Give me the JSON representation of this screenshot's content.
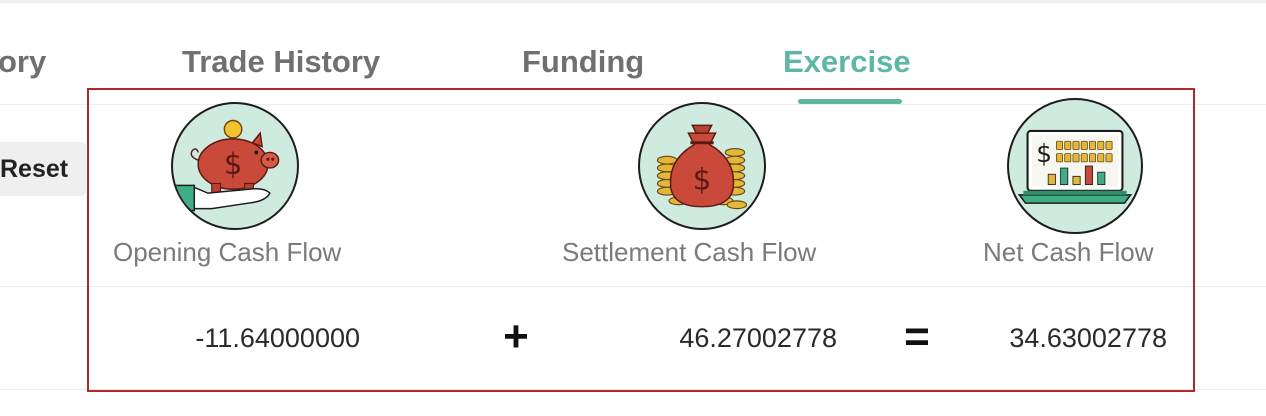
{
  "tabs": [
    {
      "label": "ory",
      "active": false
    },
    {
      "label": "Trade History",
      "active": false
    },
    {
      "label": "Funding",
      "active": false
    },
    {
      "label": "Exercise",
      "active": true
    }
  ],
  "actions": {
    "reset_label": "Reset"
  },
  "cash_flows": {
    "opening": {
      "label": "Opening Cash Flow",
      "value": "-11.64000000",
      "icon": "piggy-bank-icon"
    },
    "settlement": {
      "label": "Settlement Cash Flow",
      "value": "46.27002778",
      "icon": "money-bag-icon"
    },
    "net": {
      "label": "Net Cash Flow",
      "value": "34.63002778",
      "icon": "laptop-chart-icon"
    }
  },
  "operators": {
    "plus": "+",
    "equals": "="
  },
  "colors": {
    "accent": "#5cb8a2",
    "highlight_border": "#b0282c",
    "icon_background": "#cfeade"
  }
}
